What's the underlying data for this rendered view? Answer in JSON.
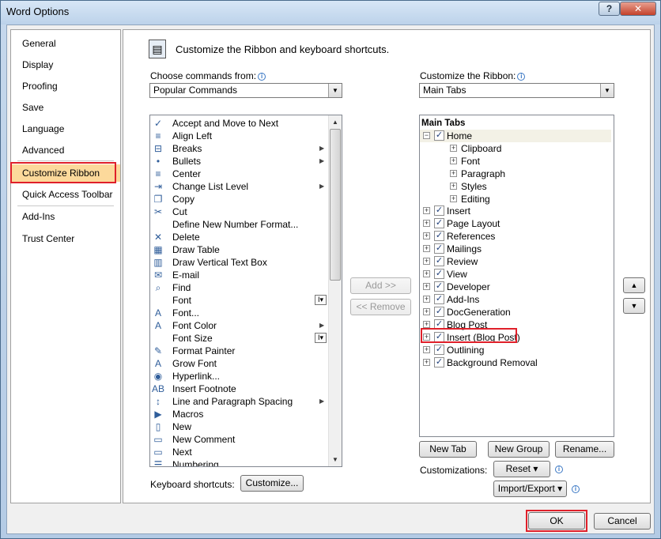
{
  "window": {
    "title": "Word Options",
    "help_label": "?",
    "close_label": "✕"
  },
  "nav": {
    "items": [
      {
        "label": "General"
      },
      {
        "label": "Display"
      },
      {
        "label": "Proofing"
      },
      {
        "label": "Save"
      },
      {
        "label": "Language"
      },
      {
        "label": "Advanced"
      },
      {
        "label": "Customize Ribbon",
        "selected": true
      },
      {
        "label": "Quick Access Toolbar"
      },
      {
        "label": "Add-Ins"
      },
      {
        "label": "Trust Center"
      }
    ]
  },
  "header": {
    "title": "Customize the Ribbon and keyboard shortcuts."
  },
  "left": {
    "label": "Choose commands from:",
    "selected": "Popular Commands",
    "commands": [
      {
        "label": "Accept and Move to Next",
        "icon": "✓"
      },
      {
        "label": "Align Left",
        "icon": "≡"
      },
      {
        "label": "Breaks",
        "icon": "⊟",
        "submenu": "▶"
      },
      {
        "label": "Bullets",
        "icon": "•",
        "submenu": "▶"
      },
      {
        "label": "Center",
        "icon": "≡"
      },
      {
        "label": "Change List Level",
        "icon": "⇥",
        "submenu": "▶"
      },
      {
        "label": "Copy",
        "icon": "❐"
      },
      {
        "label": "Cut",
        "icon": "✂"
      },
      {
        "label": "Define New Number Format...",
        "icon": ""
      },
      {
        "label": "Delete",
        "icon": "✕"
      },
      {
        "label": "Draw Table",
        "icon": "▦"
      },
      {
        "label": "Draw Vertical Text Box",
        "icon": "▥"
      },
      {
        "label": "E-mail",
        "icon": "✉"
      },
      {
        "label": "Find",
        "icon": "⌕"
      },
      {
        "label": "Font",
        "icon": "",
        "mini": "I▾"
      },
      {
        "label": "Font...",
        "icon": "A"
      },
      {
        "label": "Font Color",
        "icon": "A",
        "submenu": "▶"
      },
      {
        "label": "Font Size",
        "icon": "",
        "mini": "I▾"
      },
      {
        "label": "Format Painter",
        "icon": "✎"
      },
      {
        "label": "Grow Font",
        "icon": "A"
      },
      {
        "label": "Hyperlink...",
        "icon": "◉"
      },
      {
        "label": "Insert Footnote",
        "icon": "AB"
      },
      {
        "label": "Line and Paragraph Spacing",
        "icon": "↕",
        "submenu": "▶"
      },
      {
        "label": "Macros",
        "icon": "▶"
      },
      {
        "label": "New",
        "icon": "▯"
      },
      {
        "label": "New Comment",
        "icon": "▭"
      },
      {
        "label": "Next",
        "icon": "▭"
      },
      {
        "label": "Numbering",
        "icon": "☰"
      }
    ],
    "keyboard_label": "Keyboard shortcuts:",
    "customize_button": "Customize..."
  },
  "middle": {
    "add_button": "Add >>",
    "remove_button": "<< Remove"
  },
  "right": {
    "label": "Customize the Ribbon:",
    "selected": "Main Tabs",
    "tree_header": "Main Tabs",
    "home": {
      "label": "Home",
      "checked": true
    },
    "groups": [
      "Clipboard",
      "Font",
      "Paragraph",
      "Styles",
      "Editing"
    ],
    "tabs": [
      {
        "label": "Insert"
      },
      {
        "label": "Page Layout"
      },
      {
        "label": "References"
      },
      {
        "label": "Mailings"
      },
      {
        "label": "Review"
      },
      {
        "label": "View"
      },
      {
        "label": "Developer"
      },
      {
        "label": "Add-Ins"
      },
      {
        "label": "DocGeneration"
      },
      {
        "label": "Blog Post"
      },
      {
        "label": "Insert (Blog Post)"
      },
      {
        "label": "Outlining"
      },
      {
        "label": "Background Removal"
      }
    ],
    "new_tab_button": "New Tab",
    "new_group_button": "New Group",
    "rename_button": "Rename...",
    "customizations_label": "Customizations:",
    "reset_button": "Reset ▾",
    "import_export_button": "Import/Export ▾"
  },
  "footer": {
    "ok_button": "OK",
    "cancel_button": "Cancel"
  },
  "colors": {
    "selected_nav": "#fcd99b",
    "highlight_red": "#e0202a"
  }
}
